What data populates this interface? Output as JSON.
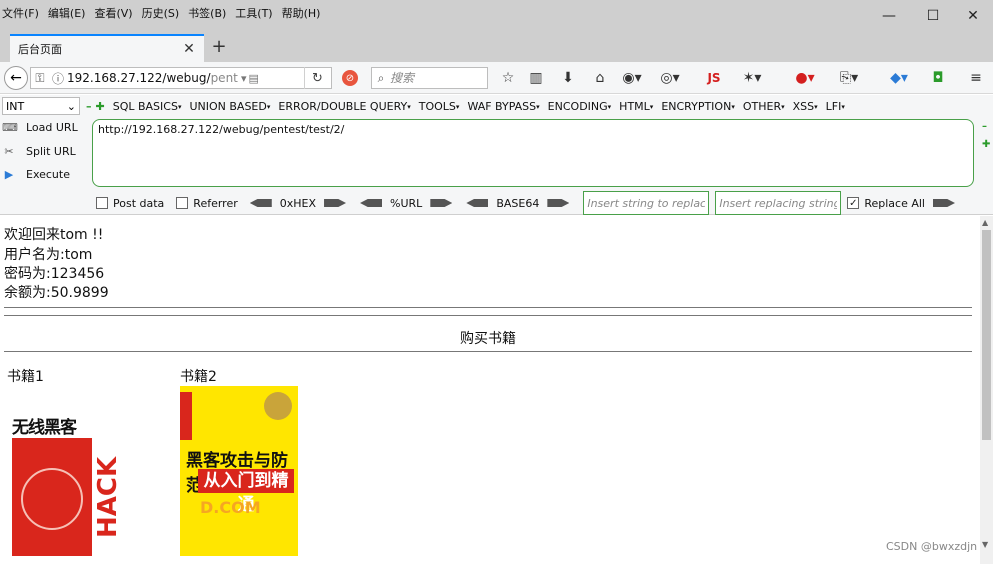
{
  "menubar": {
    "items": [
      "文件(F)",
      "编辑(E)",
      "查看(V)",
      "历史(S)",
      "书签(B)",
      "工具(T)",
      "帮助(H)"
    ]
  },
  "window_controls": {
    "minimize": "—",
    "maximize": "☐",
    "close": "✕"
  },
  "tab": {
    "title": "后台页面",
    "close": "✕",
    "new_tab": "+"
  },
  "navbar": {
    "url_main": "192.168.27.122/webug/",
    "url_dim": "pent",
    "search_placeholder": "搜索"
  },
  "hackbar": {
    "select_value": "INT",
    "menus": [
      "SQL BASICS",
      "UNION BASED",
      "ERROR/DOUBLE QUERY",
      "TOOLS",
      "WAF BYPASS",
      "ENCODING",
      "HTML",
      "ENCRYPTION",
      "OTHER",
      "XSS",
      "LFI"
    ],
    "actions": {
      "load": "Load URL",
      "split": "Split URL",
      "execute": "Execute"
    },
    "url_value": "http://192.168.27.122/webug/pentest/test/2/",
    "post_data": "Post data",
    "referrer": "Referrer",
    "hex": "0xHEX",
    "url_enc": "%URL",
    "base64": "BASE64",
    "insert_placeholder": "Insert string to replace",
    "replacing_placeholder": "Insert replacing string",
    "replace_all": "Replace All",
    "replace_all_checked": true
  },
  "page": {
    "welcome": "欢迎回来tom !!",
    "username": "用户名为:tom",
    "password": "密码为:123456",
    "balance": "余额为:50.9899",
    "section_title": "购买书籍",
    "book1_label": "书籍1",
    "book2_label": "书籍2",
    "book1_cover": {
      "title": "无线黑客",
      "hack": "HACK"
    },
    "book2_cover": {
      "title_line1": "黑客攻击与防范",
      "title_line2": "从入门到精通",
      "sub": "D.COM"
    }
  },
  "watermark": "CSDN @bwxzdjn",
  "colors": {
    "tab_accent": "#0a84ff",
    "hackbar_green": "#49a049",
    "cover_red": "#d9261c",
    "cover_yellow": "#ffe600"
  }
}
